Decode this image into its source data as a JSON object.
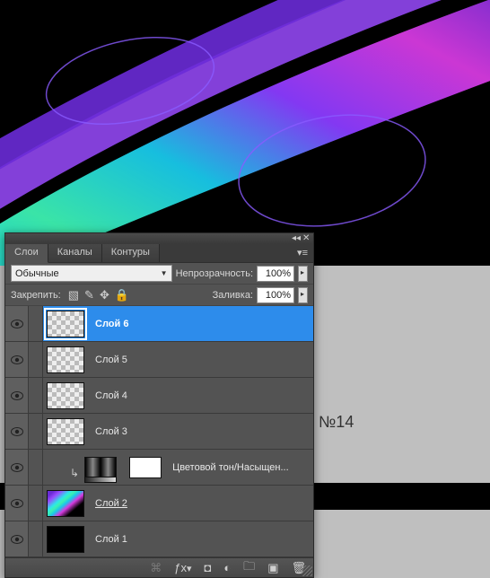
{
  "doc_label": "№14",
  "panel": {
    "tabs": [
      "Слои",
      "Каналы",
      "Контуры"
    ],
    "active_tab": 0,
    "blend_mode": "Обычные",
    "opacity_label": "Непрозрачность:",
    "opacity_value": "100%",
    "lock_label": "Закрепить:",
    "fill_label": "Заливка:",
    "fill_value": "100%",
    "layers": [
      {
        "name": "Слой 6",
        "thumb": "checker",
        "active": true
      },
      {
        "name": "Слой 5",
        "thumb": "checker"
      },
      {
        "name": "Слой 4",
        "thumb": "checker"
      },
      {
        "name": "Слой 3",
        "thumb": "checker"
      },
      {
        "name": "Цветовой тон/Насыщен...",
        "thumb": "adjust",
        "clipped": true
      },
      {
        "name": "Слой 2",
        "thumb": "stripes",
        "underline": true
      },
      {
        "name": "Слой 1",
        "thumb": "black"
      }
    ]
  }
}
